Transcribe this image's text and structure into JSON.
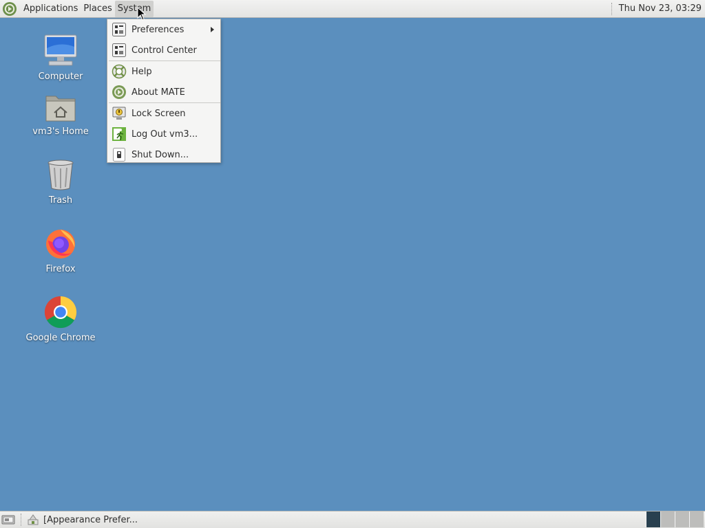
{
  "top_panel": {
    "menus": [
      "Applications",
      "Places",
      "System"
    ],
    "clock": "Thu Nov 23, 03:29"
  },
  "desktop_icons": [
    {
      "label": "Computer",
      "icon": "computer-icon"
    },
    {
      "label": "vm3's Home",
      "icon": "home-folder-icon"
    },
    {
      "label": "Trash",
      "icon": "trash-icon"
    },
    {
      "label": "Firefox",
      "icon": "firefox-icon"
    },
    {
      "label": "Google Chrome",
      "icon": "chrome-icon"
    }
  ],
  "system_menu": {
    "items": [
      {
        "label": "Preferences",
        "icon": "preferences-icon",
        "has_submenu": true
      },
      {
        "label": "Control Center",
        "icon": "control-center-icon"
      },
      {
        "label": "Help",
        "icon": "help-icon"
      },
      {
        "label": "About MATE",
        "icon": "mate-icon"
      },
      {
        "label": "Lock Screen",
        "icon": "lock-screen-icon"
      },
      {
        "label": "Log Out vm3...",
        "icon": "log-out-icon"
      },
      {
        "label": "Shut Down...",
        "icon": "shut-down-icon"
      }
    ]
  },
  "bottom_panel": {
    "task_label": "[Appearance Prefer...",
    "workspaces": [
      true,
      false,
      false,
      false
    ]
  },
  "colors": {
    "desktop": "#5b8fbe",
    "active_workspace": "#29404f"
  }
}
